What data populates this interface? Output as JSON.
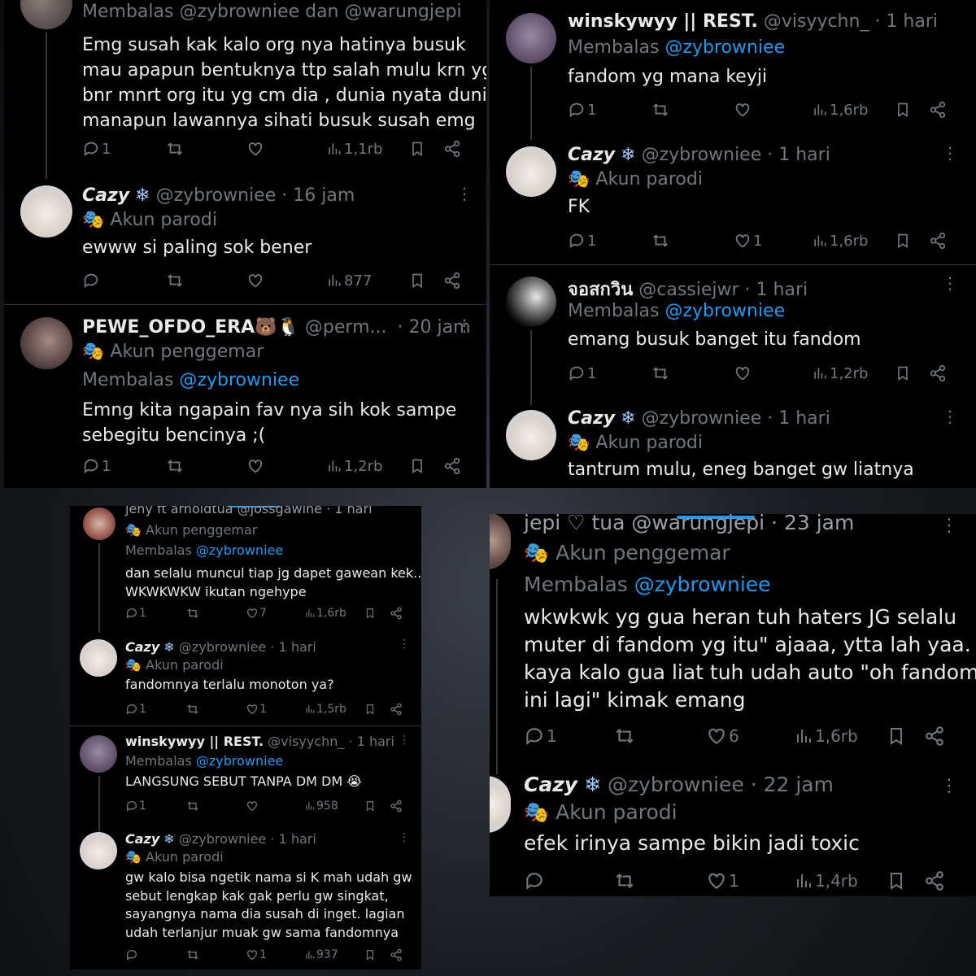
{
  "panel_tl": {
    "tweets": [
      {
        "header": "Membalas @zybrowniee dan @warungjepi",
        "text_lines": [
          "Emg susah kak kalo org nya hatinya busuk",
          "mau apapun bentuknya ttp salah mulu krn yg",
          "bnr mnrt org itu yg cm dia , dunia nyata dunia",
          "manapun lawannya sihati busuk susah emg"
        ],
        "replies": "1",
        "likes": "",
        "views": "1,1rb"
      },
      {
        "name": "Cazy",
        "handle": "@zybrowniee",
        "time": "· 16 jam",
        "badge": "Akun parodi",
        "text_lines": [
          "ewww si paling sok bener"
        ],
        "replies": "",
        "likes": "",
        "views": "877"
      },
      {
        "name": "PEWE_OFDO_ERA🐻🐧",
        "handle": "@perm...",
        "time": "· 20 jam",
        "badge": "Akun penggemar",
        "reply_prefix": "Membalas",
        "reply_to": "@zybrowniee",
        "text_lines": [
          "Emng kita ngapain fav nya sih kok sampe",
          "sebegitu bencinya ;("
        ],
        "replies": "1",
        "likes": "",
        "views": "1,2rb"
      }
    ]
  },
  "panel_tr": {
    "tweets": [
      {
        "name": "winskywyy || REST.",
        "handle": "@visyychn_",
        "time": "· 1 hari",
        "reply_prefix": "Membalas",
        "reply_to": "@zybrowniee",
        "text_lines": [
          "fandom yg mana keyji"
        ],
        "replies": "1",
        "likes": "",
        "views": "1,6rb"
      },
      {
        "name": "Cazy",
        "handle": "@zybrowniee",
        "time": "· 1 hari",
        "badge": "Akun parodi",
        "text_lines": [
          "FK"
        ],
        "replies": "1",
        "likes": "1",
        "views": "1,6rb"
      },
      {
        "name": "จอสกวิน",
        "handle": "@cassiejwr",
        "time": "· 1 hari",
        "reply_prefix": "Membalas",
        "reply_to": "@zybrowniee",
        "text_lines": [
          "emang busuk banget itu fandom"
        ],
        "replies": "1",
        "likes": "",
        "views": "1,2rb"
      },
      {
        "name": "Cazy",
        "handle": "@zybrowniee",
        "time": "· 1 hari",
        "badge": "Akun parodi",
        "text_lines": [
          "tantrum mulu, eneg banget gw liatnya"
        ]
      }
    ]
  },
  "panel_bl": {
    "tweets": [
      {
        "header": "jeny ft arnoldtua @jossgawine · 1 hari",
        "badge": "Akun penggemar",
        "reply_prefix": "Membalas",
        "reply_to": "@zybrowniee",
        "text_lines": [
          "dan selalu muncul tiap jg dapet gawean kek..",
          "WKWKWKW ikutan ngehype"
        ],
        "replies": "1",
        "likes": "7",
        "views": "1,6rb"
      },
      {
        "name": "Cazy",
        "handle": "@zybrowniee",
        "time": "· 1 hari",
        "badge": "Akun parodi",
        "text_lines": [
          "fandomnya terlalu monoton ya?"
        ],
        "replies": "1",
        "likes": "1",
        "views": "1,5rb"
      },
      {
        "name": "winskywyy || REST.",
        "handle": "@visyychn_",
        "time": "· 1 hari",
        "reply_prefix": "Membalas",
        "reply_to": "@zybrowniee",
        "text_lines": [
          "LANGSUNG SEBUT TANPA DM DM 😭"
        ],
        "replies": "1",
        "likes": "",
        "views": "958"
      },
      {
        "name": "Cazy",
        "handle": "@zybrowniee",
        "time": "· 1 hari",
        "badge": "Akun parodi",
        "text_lines": [
          "gw kalo bisa ngetik nama si K mah udah gw",
          "sebut lengkap kak gak perlu gw singkat,",
          "sayangnya nama dia susah di inget. lagian",
          "udah terlanjur muak gw sama fandomnya"
        ],
        "replies": "",
        "likes": "1",
        "views": "937"
      }
    ]
  },
  "panel_br": {
    "tweets": [
      {
        "header": "jepi ♡ tua @warungjepi · 23 jam",
        "badge": "Akun penggemar",
        "reply_prefix": "Membalas",
        "reply_to": "@zybrowniee",
        "text_lines": [
          "wkwkwk yg gua heran tuh haters JG selalu",
          "muter di fandom yg itu\" ajaaa, ytta lah yaa.",
          "kaya kalo gua liat tuh udah auto \"oh fandom",
          "ini lagi\" kimak emang"
        ],
        "replies": "1",
        "likes": "6",
        "views": "1,6rb"
      },
      {
        "name": "Cazy",
        "handle": "@zybrowniee",
        "time": "· 22 jam",
        "badge": "Akun parodi",
        "text_lines": [
          "efek irinya sampe bikin jadi toxic"
        ],
        "replies": "",
        "likes": "1",
        "views": "1,4rb"
      }
    ]
  },
  "icons": {
    "reply": "reply-icon",
    "retweet": "retweet-icon",
    "like": "heart-icon",
    "views": "views-icon",
    "bookmark": "bookmark-icon",
    "share": "share-icon",
    "more": "more-dots-icon",
    "badge": "mask-icon",
    "verified": "snowflake-icon"
  },
  "colors": {
    "accent": "#1d9bf0",
    "muted": "#71767b",
    "text": "#e7e9ea",
    "bg": "#000000"
  }
}
